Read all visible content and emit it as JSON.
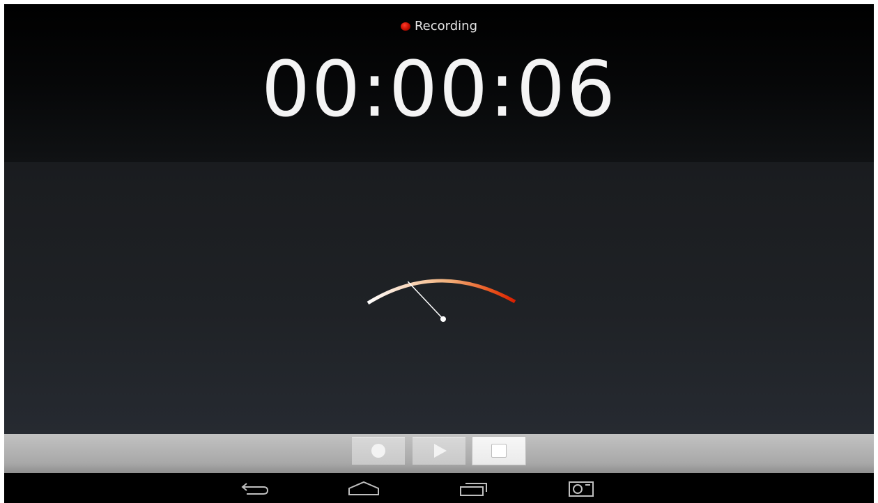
{
  "status": {
    "label": "Recording",
    "indicator_color": "#c40f00"
  },
  "timer": {
    "elapsed": "00:00:06"
  },
  "meter": {
    "level": 0.2,
    "arc_colors": [
      "#ffffff",
      "#f2b07a",
      "#e8501a",
      "#d81e00"
    ]
  },
  "controls": {
    "record_icon": "record-icon",
    "play_icon": "play-icon",
    "stop_icon": "stop-icon",
    "active": "stop"
  },
  "navigation": {
    "back_icon": "back-icon",
    "home_icon": "home-icon",
    "recents_icon": "recent-apps-icon",
    "screenshot_icon": "screenshot-icon"
  },
  "colors": {
    "background_top": "#000000",
    "background_meter": "#1f2226",
    "control_bar": "#a8a8a8",
    "text": "#f4f4f4"
  }
}
